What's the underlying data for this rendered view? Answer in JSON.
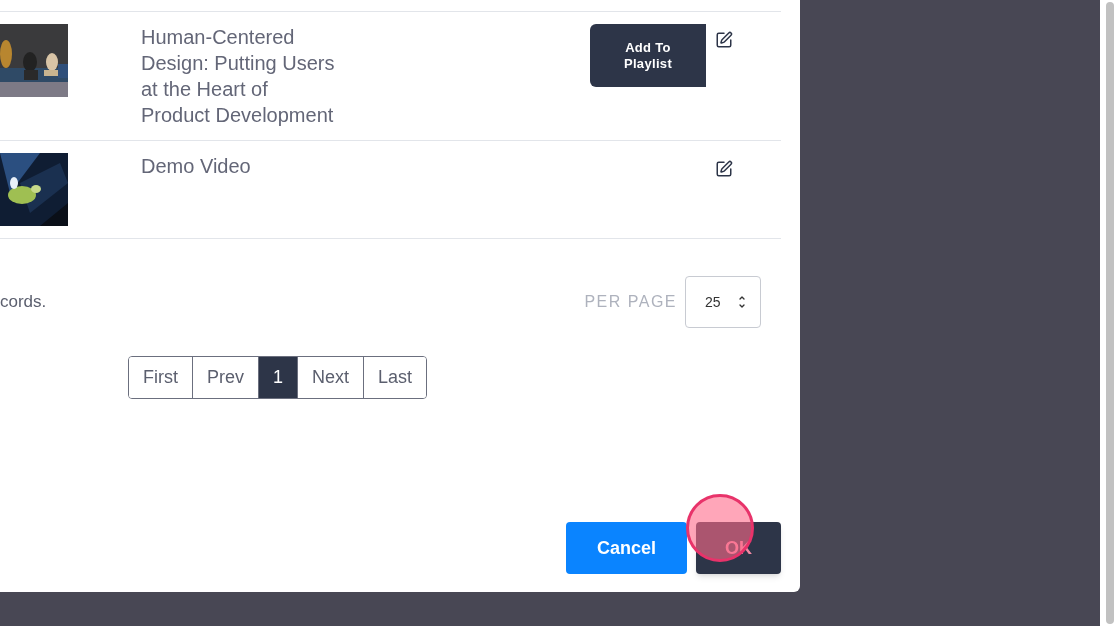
{
  "rows": [
    {
      "title": "Human-Centered Design: Putting Users at the Heart of Product Development",
      "action": "Add To Playlist"
    },
    {
      "title": "Demo Video"
    }
  ],
  "footer": {
    "records_text": "cords.",
    "per_page_label": "PER PAGE",
    "per_page_value": "25"
  },
  "pagination": [
    {
      "label": "First",
      "selected": false
    },
    {
      "label": "Prev",
      "selected": false
    },
    {
      "label": "1",
      "selected": true
    },
    {
      "label": "Next",
      "selected": false
    },
    {
      "label": "Last",
      "selected": false
    }
  ],
  "dialog_buttons": [
    {
      "label": "Cancel",
      "kind": "secondary"
    },
    {
      "label": "OK",
      "kind": "primary"
    }
  ]
}
